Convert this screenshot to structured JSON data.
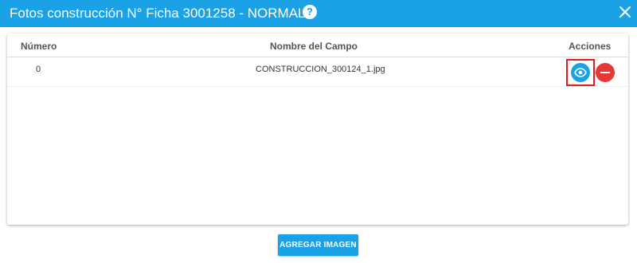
{
  "dialog": {
    "title": "Fotos construcción N° Ficha 3001258 - NORMAL",
    "help_icon_label": "?",
    "icons": {
      "help": "help-circle-icon",
      "close": "close-icon"
    },
    "colors": {
      "header": "#1ba1e6",
      "view": "#1ba1e6",
      "delete": "#e53935",
      "highlight": "#e21b1b"
    }
  },
  "table": {
    "headers": {
      "number": "Número",
      "name": "Nombre del Campo",
      "actions": "Acciones"
    },
    "rows": [
      {
        "number": "0",
        "name": "CONSTRUCCION_300124_1.jpg",
        "actions": [
          "eye-icon",
          "minus-icon"
        ]
      }
    ]
  },
  "footer": {
    "add_image_label": "AGREGAR IMAGEN"
  }
}
